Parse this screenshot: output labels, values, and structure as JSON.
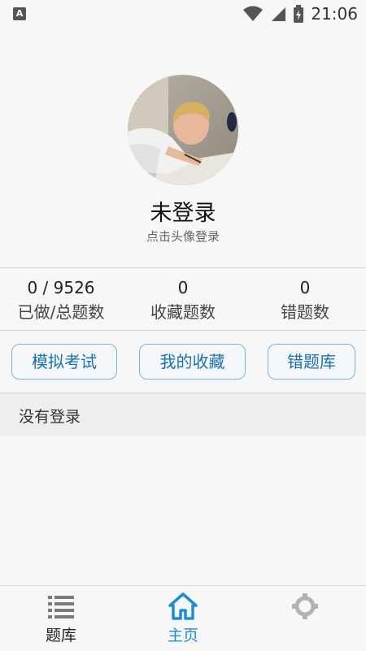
{
  "status_bar": {
    "left_icon": "A",
    "time": "21:06",
    "icons": [
      "notification-a-icon",
      "wifi-icon",
      "signal-icon",
      "battery-charging-icon"
    ]
  },
  "profile": {
    "avatar_icon": "avatar-photo",
    "username": "未登录",
    "login_hint": "点击头像登录"
  },
  "stats": [
    {
      "value": "0 / 9526",
      "label": "已做/总题数"
    },
    {
      "value": "0",
      "label": "收藏题数"
    },
    {
      "value": "0",
      "label": "错题数"
    }
  ],
  "actions": [
    {
      "label": "模拟考试"
    },
    {
      "label": "我的收藏"
    },
    {
      "label": "错题库"
    }
  ],
  "info": {
    "text": "没有登录"
  },
  "bottom_nav": {
    "active_color": "#1a8fd6",
    "inactive_color": "#7a7a7a",
    "items": [
      {
        "label": "题库",
        "icon": "list-icon",
        "active": false
      },
      {
        "label": "主页",
        "icon": "home-icon",
        "active": true
      },
      {
        "label": "",
        "icon": "gear-icon",
        "active": false
      }
    ]
  }
}
